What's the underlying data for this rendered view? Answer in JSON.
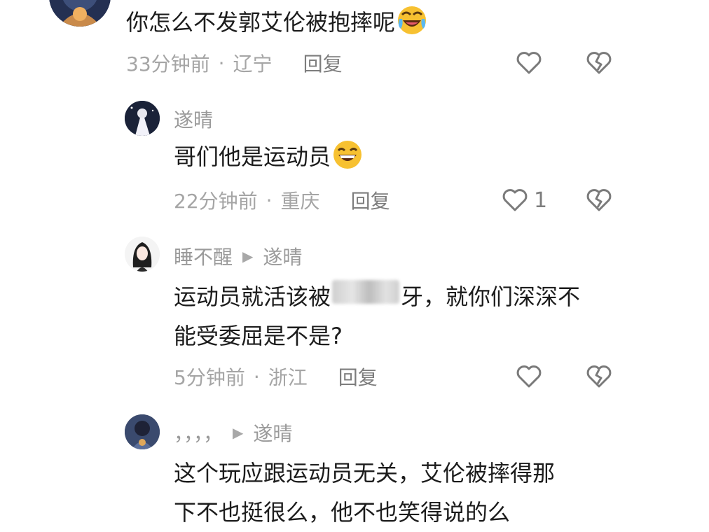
{
  "comments": [
    {
      "name": "",
      "text": "你怎么不发郭艾伦被抱摔呢",
      "emoji": "rolling-laughing-emoji",
      "time": "33分钟前",
      "location": "辽宁",
      "reply_label": "回复",
      "like_count": ""
    },
    {
      "name": "遂晴",
      "text": "哥们他是运动员",
      "emoji": "grinning-emoji",
      "time": "22分钟前",
      "location": "重庆",
      "reply_label": "回复",
      "like_count": "1"
    },
    {
      "name": "睡不醒",
      "reply_to": "遂晴",
      "text_line1_a": "运动员就活该被",
      "text_line1_blur": "xx",
      "text_line1_b": "牙，就你们深深不",
      "text_line2": "能受委屈是不是?",
      "time": "5分钟前",
      "location": "浙江",
      "reply_label": "回复",
      "like_count": ""
    },
    {
      "name": "，，，，",
      "reply_to": "遂晴",
      "text_line1": "这个玩应跟运动员无关，艾伦被摔得那",
      "text_line2": "下不也挺很么，他不也笑得说的么"
    }
  ],
  "separator": "·",
  "icons": {
    "like": "heart-outline-icon",
    "dislike": "broken-heart-icon",
    "reply_arrow": "play-triangle-icon"
  },
  "colors": {
    "text": "#1c1c1c",
    "meta": "#a5a5a5",
    "icon": "#7a7a7a"
  }
}
